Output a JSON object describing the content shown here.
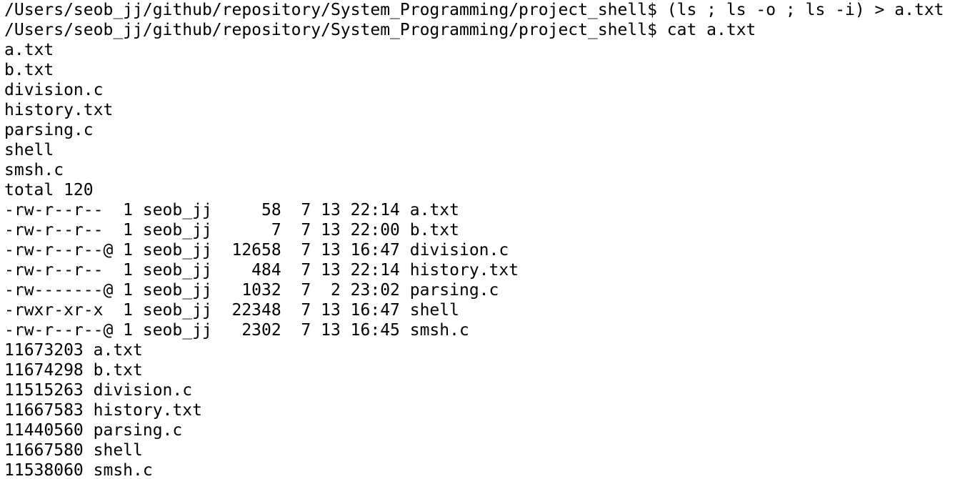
{
  "terminal": {
    "lines": [
      "/Users/seob_jj/github/repository/System_Programming/project_shell$ (ls ; ls -o ; ls -i) > a.txt",
      "/Users/seob_jj/github/repository/System_Programming/project_shell$ cat a.txt",
      "a.txt",
      "b.txt",
      "division.c",
      "history.txt",
      "parsing.c",
      "shell",
      "smsh.c",
      "total 120",
      "-rw-r--r--  1 seob_jj     58  7 13 22:14 a.txt",
      "-rw-r--r--  1 seob_jj      7  7 13 22:00 b.txt",
      "-rw-r--r--@ 1 seob_jj  12658  7 13 16:47 division.c",
      "-rw-r--r--  1 seob_jj    484  7 13 22:14 history.txt",
      "-rw-------@ 1 seob_jj   1032  7  2 23:02 parsing.c",
      "-rwxr-xr-x  1 seob_jj  22348  7 13 16:47 shell",
      "-rw-r--r--@ 1 seob_jj   2302  7 13 16:45 smsh.c",
      "11673203 a.txt",
      "11674298 b.txt",
      "11515263 division.c",
      "11667583 history.txt",
      "11440560 parsing.c",
      "11667580 shell",
      "11538060 smsh.c"
    ]
  }
}
